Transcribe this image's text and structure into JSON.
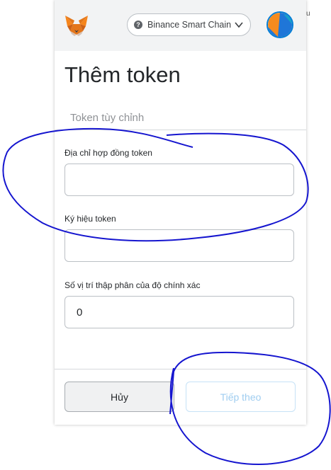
{
  "background_stub_text": "u",
  "header": {
    "network_label": "Binance Smart Chain",
    "help_icon_glyph": "?",
    "icons": [
      "metamask-fox-icon",
      "question-circle-icon",
      "chevron-down-icon",
      "account-avatar-icon"
    ]
  },
  "page": {
    "title": "Thêm token",
    "tab": "Token tùy chỉnh"
  },
  "form": {
    "contract_address": {
      "label": "Địa chỉ hợp đồng token",
      "value": ""
    },
    "symbol": {
      "label": "Ký hiệu token",
      "value": ""
    },
    "decimals": {
      "label": "Số vị trí thập phân của độ chính xác",
      "value": "0"
    }
  },
  "footer": {
    "cancel_label": "Hủy",
    "next_label": "Tiếp theo"
  },
  "colors": {
    "header_bg": "#f2f3f4",
    "border": "#bbc0c5",
    "next_disabled_text": "#9fcdf0",
    "annotation_ink": "#1010c8"
  }
}
